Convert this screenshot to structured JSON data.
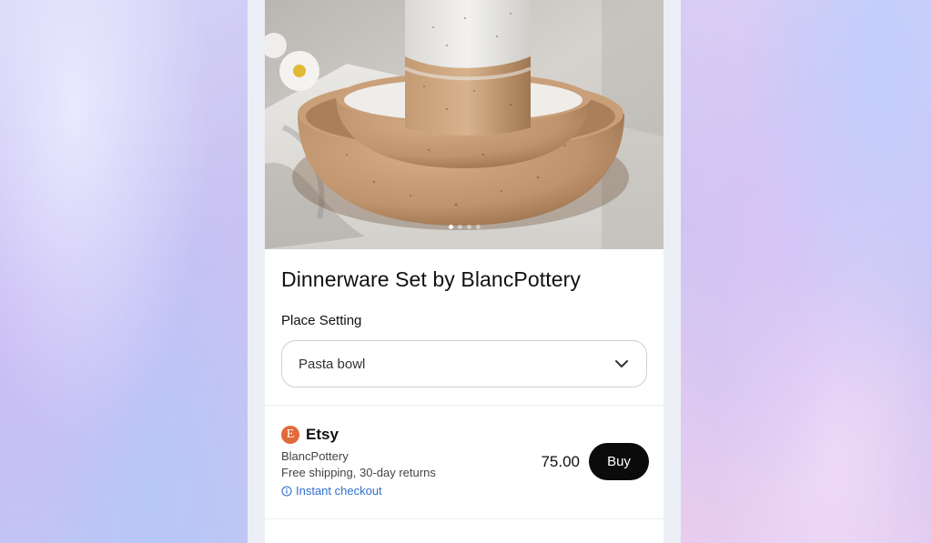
{
  "product": {
    "title": "Dinnerware Set by BlancPottery",
    "image_icon": "ceramic-bowls-photo",
    "carousel": {
      "count": 4,
      "active": 1
    }
  },
  "option": {
    "label": "Place Setting",
    "selected": "Pasta bowl"
  },
  "offer": {
    "merchant": "Etsy",
    "merchant_logo_letter": "E",
    "merchant_color": "#e2693a",
    "seller": "BlancPottery",
    "shipping": "Free shipping, 30-day returns",
    "checkout": "Instant checkout",
    "price": "75.00",
    "buy_label": "Buy"
  }
}
